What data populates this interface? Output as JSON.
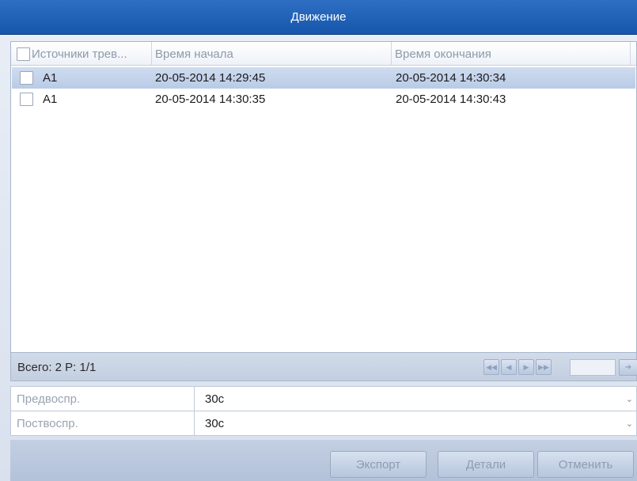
{
  "dialog": {
    "title": "Движение"
  },
  "table": {
    "columns": [
      "Источники трев...",
      "Время начала",
      "Время окончания"
    ],
    "rows": [
      {
        "source": "A1",
        "start": "20-05-2014 14:29:45",
        "end": "20-05-2014 14:30:34",
        "selected": true
      },
      {
        "source": "A1",
        "start": "20-05-2014 14:30:35",
        "end": "20-05-2014 14:30:43",
        "selected": false
      }
    ]
  },
  "status": {
    "text": "Всего: 2  P: 1/1"
  },
  "pager": {
    "first_icon": "first-page-icon",
    "prev_icon": "prev-page-icon",
    "next_icon": "next-page-icon",
    "last_icon": "last-page-icon",
    "go_icon": "go-arrow-icon",
    "page_value": ""
  },
  "settings": {
    "prerecord": {
      "label": "Предвоспр.",
      "value": "30с"
    },
    "postrecord": {
      "label": "Поствоспр.",
      "value": "30с"
    }
  },
  "buttons": {
    "export": "Экспорт",
    "details": "Детали",
    "cancel": "Отменить"
  },
  "colors": {
    "titlebar": "#1e62b8",
    "selected_row": "#c4d4ec",
    "accent": "#2e6fc3"
  }
}
